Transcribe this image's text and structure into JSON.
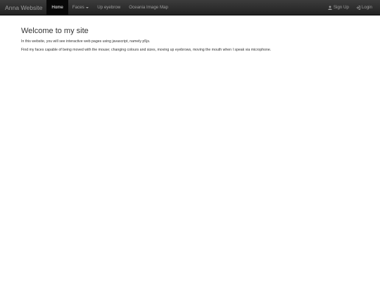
{
  "navbar": {
    "brand": "Anna Website",
    "items": [
      {
        "label": "Home",
        "active": true
      },
      {
        "label": "Faces",
        "dropdown": true
      },
      {
        "label": "Up eyebrow"
      },
      {
        "label": "Oceania Image Map"
      }
    ],
    "right": [
      {
        "label": "Sign Up",
        "icon": "user-icon"
      },
      {
        "label": "Login",
        "icon": "login-icon"
      }
    ],
    "colors": {
      "background": "#222222",
      "active_bg": "#080808",
      "text": "#9d9d9d",
      "active_text": "#ffffff"
    }
  },
  "main": {
    "title": "Welcome to my site",
    "paragraphs": [
      "In this website, you will see interactive web pages using javascript, namely p5js.",
      "Find my faces capable of being moved with the mouse; changing colours and sizes, moving up eyebrows, moving the mouth when I speak via microphone."
    ]
  }
}
